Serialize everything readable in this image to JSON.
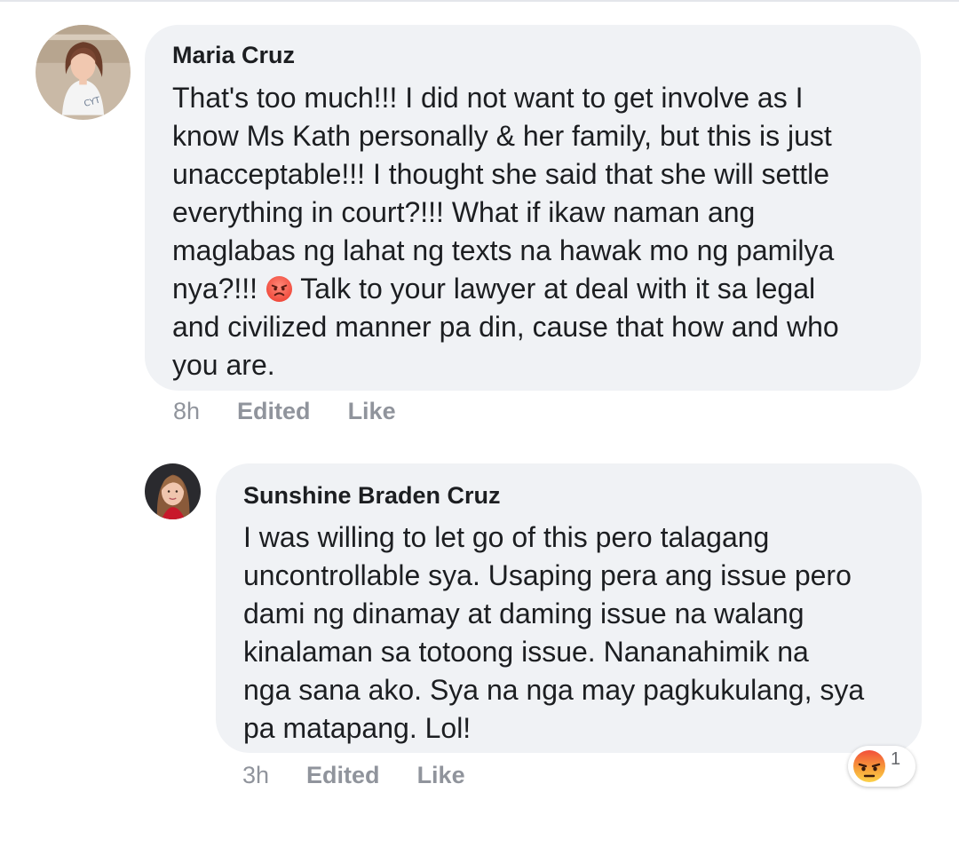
{
  "comments": [
    {
      "author": "Maria Cruz",
      "text_before_emoji": "That's too much!!!  I did not want to get involve as I\nknow Ms Kath personally & her family, but this is just\nunacceptable!!! I thought she said that she will settle\neverything in court?!!! What if ikaw naman ang\nmaglabas ng lahat ng texts na hawak mo ng pamilya\nnya?!!! ",
      "emoji": "angry-face-icon",
      "text_after_emoji": " Talk to your lawyer at deal with it sa legal\nand civilized manner pa din, cause that how and who\nyou are.",
      "time": "8h",
      "edited_label": "Edited",
      "like_label": "Like"
    },
    {
      "author": "Sunshine Braden Cruz",
      "text": "I was willing to let go of this pero talagang\nuncontrollable sya. Usaping pera ang issue pero\ndami ng dinamay at daming issue na walang\nkinalaman sa totoong issue. Nananahimik na\nnga sana ako. Sya na nga may pagkukulang, sya\npa matapang. Lol!",
      "time": "3h",
      "edited_label": "Edited",
      "like_label": "Like",
      "reaction": {
        "icon": "angry-reaction-icon",
        "count": "1"
      }
    }
  ],
  "colors": {
    "bubble": "#f0f2f5",
    "meta_text": "#90949c",
    "body_text": "#1c1e21"
  }
}
